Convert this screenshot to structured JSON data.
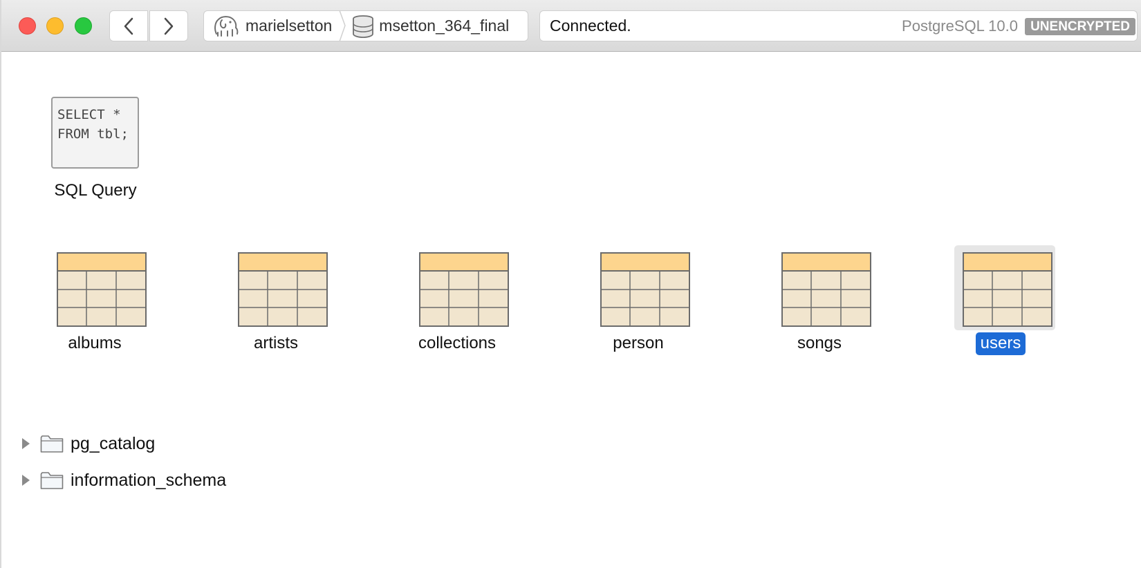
{
  "toolbar": {
    "breadcrumb": {
      "server": "marielsetton",
      "database": "msetton_364_final"
    },
    "status": {
      "message": "Connected.",
      "server_version": "PostgreSQL 10.0",
      "encryption": "UNENCRYPTED"
    }
  },
  "sql_query": {
    "preview_code": "SELECT *\nFROM tbl;",
    "label": "SQL Query"
  },
  "tables": [
    {
      "name": "albums",
      "selected": false
    },
    {
      "name": "artists",
      "selected": false
    },
    {
      "name": "collections",
      "selected": false
    },
    {
      "name": "person",
      "selected": false
    },
    {
      "name": "songs",
      "selected": false
    },
    {
      "name": "users",
      "selected": true
    }
  ],
  "schemas": [
    {
      "name": "pg_catalog"
    },
    {
      "name": "information_schema"
    }
  ],
  "colors": {
    "table_header": "#fdd58e",
    "table_cell": "#f1e5ce",
    "selection": "#1d6bd6"
  }
}
